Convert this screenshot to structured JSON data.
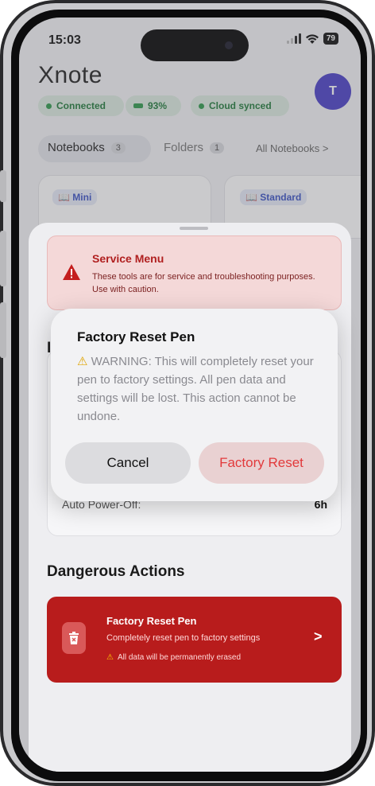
{
  "status_bar": {
    "time": "15:03",
    "battery": "79"
  },
  "app": {
    "logo": "Xnote",
    "avatar_initial": "T",
    "chips": {
      "connected": "Connected",
      "battery": "93%",
      "cloud": "Cloud synced"
    },
    "tabs": [
      {
        "label": "Notebooks",
        "count": "3"
      },
      {
        "label": "Folders",
        "count": "1"
      }
    ],
    "all_notebooks_link": "All Notebooks >",
    "notebook_cards": [
      "Mini",
      "Standard"
    ]
  },
  "sheet": {
    "service_menu": {
      "title": "Service Menu",
      "text": "These tools are for service and troubleshooting purposes. Use with caution."
    },
    "section_partial_letter": "I",
    "auto_power_off": {
      "label": "Auto Power-Off:",
      "value": "6h"
    },
    "dangerous_actions": {
      "title": "Dangerous Actions",
      "item_title": "Factory Reset Pen",
      "item_subtitle": "Completely reset pen to factory settings",
      "item_warning": "All data will be permanently erased",
      "chevron": ">"
    }
  },
  "alert": {
    "title": "Factory Reset Pen",
    "message": "WARNING: This will completely reset your pen to factory settings. All pen data and settings will be lost. This action cannot be undone.",
    "cancel_label": "Cancel",
    "confirm_label": "Factory Reset"
  },
  "colors": {
    "avatar": "#4a40c8",
    "connected_green": "#2e9a4c",
    "danger_red": "#b81c1c",
    "destructive_text": "#e2393b",
    "warning_yellow": "#e0a400"
  },
  "icons": {
    "service_menu": "warning-triangle-icon",
    "danger_item": "trash-icon",
    "notebook_cards": "book-icon"
  }
}
